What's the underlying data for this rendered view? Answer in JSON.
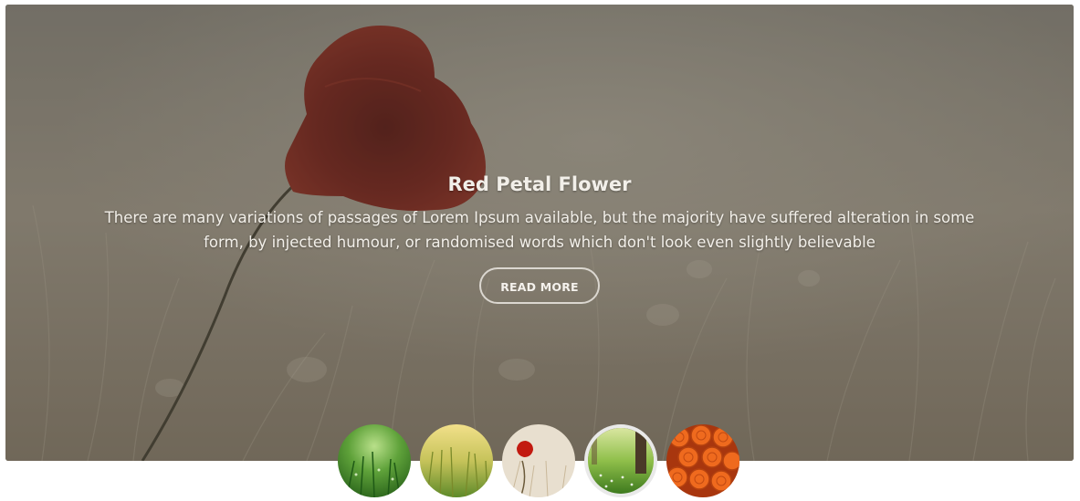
{
  "slide": {
    "title": "Red Petal Flower",
    "description": "There are many variations of passages of Lorem Ipsum available, but the majority have suffered alteration in some form, by injected humour, or randomised words which don't look even slightly believable",
    "button_label": "READ MORE"
  },
  "thumbnails": [
    {
      "icon": "green-grass-dew-thumbnail",
      "active": false
    },
    {
      "icon": "yellow-wheat-field-thumbnail",
      "active": false
    },
    {
      "icon": "red-poppy-thumbnail",
      "active": false
    },
    {
      "icon": "forest-meadow-thumbnail",
      "active": true
    },
    {
      "icon": "orange-roses-thumbnail",
      "active": false
    }
  ],
  "colors": {
    "overlay": "#46423a",
    "poppy": "#7c1a12",
    "button_border": "#ebe8e2",
    "active_thumb_border": "#e9e9e9"
  }
}
